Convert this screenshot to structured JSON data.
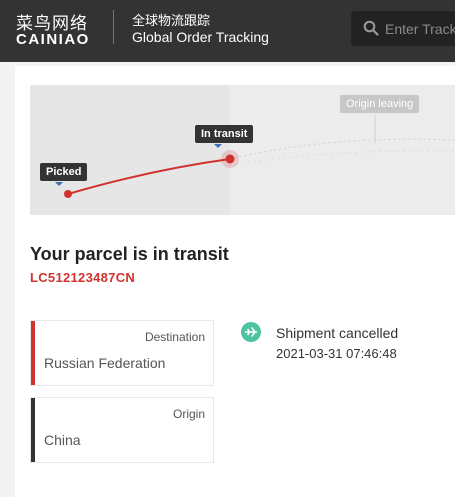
{
  "header": {
    "logo_cn": "菜鸟网络",
    "logo_en": "CAINIAO",
    "title_cn": "全球物流跟踪",
    "title_en": "Global Order Tracking",
    "search_placeholder": "Enter Tracking Number"
  },
  "map": {
    "labels": {
      "picked": "Picked",
      "in_transit": "In transit",
      "origin_leaving": "Origin leaving"
    }
  },
  "parcel": {
    "status_title": "Your parcel is in transit",
    "tracking_number": "LC512123487CN"
  },
  "route": {
    "destination_label": "Destination",
    "destination_value": "Russian Federation",
    "origin_label": "Origin",
    "origin_value": "China"
  },
  "event": {
    "icon": "plane-icon",
    "title": "Shipment cancelled",
    "time": "2021-03-31 07:46:48"
  },
  "colors": {
    "header_bg": "#333333",
    "accent_red": "#d0332d",
    "event_green": "#4fc3a1",
    "origin_bar": "#333333"
  }
}
